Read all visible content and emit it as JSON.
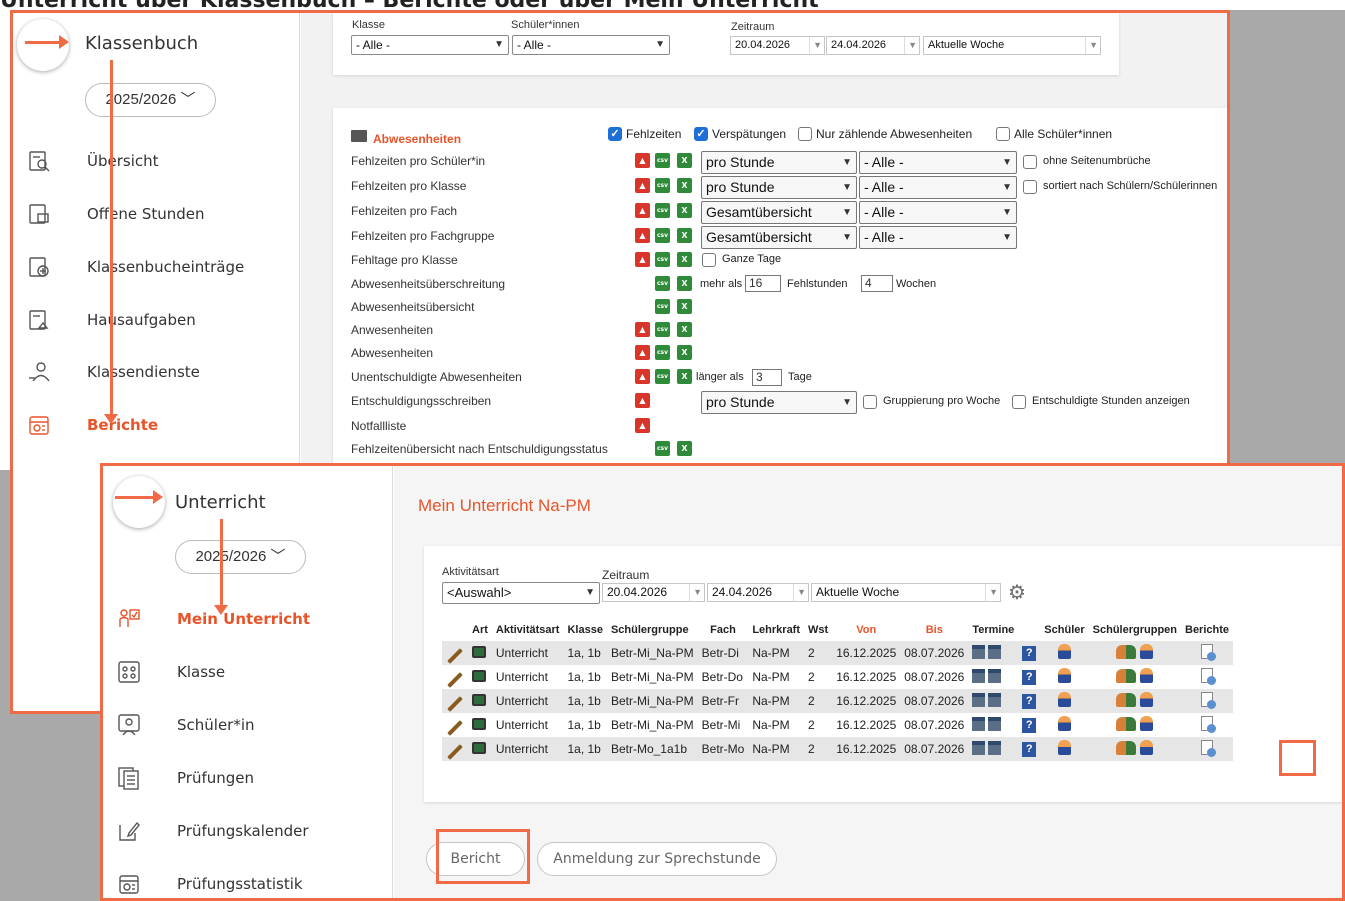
{
  "heading": "Unterricht über Klassenbuch – Berichte oder über Mein Unterricht",
  "colors": {
    "accent": "#e8542a",
    "highlight_border": "#ef6a45",
    "checkbox": "#1f6fd8",
    "pdf": "#d9352b",
    "excel": "#2f8a3a"
  },
  "klassenbuch": {
    "sidebar": {
      "title": "Klassenbuch",
      "school_year": "2025/2026",
      "items": [
        {
          "label": "Übersicht",
          "icon": "overview-icon"
        },
        {
          "label": "Offene Stunden",
          "icon": "open-lessons-icon"
        },
        {
          "label": "Klassenbucheinträge",
          "icon": "entry-icon"
        },
        {
          "label": "Hausaufgaben",
          "icon": "homework-icon"
        },
        {
          "label": "Klassendienste",
          "icon": "class-duties-icon"
        },
        {
          "label": "Berichte",
          "icon": "reports-icon",
          "active": true
        }
      ]
    },
    "filters": {
      "klasse_label": "Klasse",
      "klasse_value": "- Alle -",
      "schueler_label": "Schüler*innen",
      "schueler_value": "- Alle -",
      "zeitraum_label": "Zeitraum",
      "date_from": "20.04.2026",
      "date_to": "24.04.2026",
      "period": "Aktuelle Woche"
    },
    "absences": {
      "section_title": "Abwesenheiten",
      "options": {
        "fehlzeiten": "Fehlzeiten",
        "verspaetungen": "Verspätungen",
        "nur_zaehlende": "Nur zählende Abwesenheiten",
        "alle_schueler": "Alle Schüler*innen"
      },
      "rows": [
        {
          "label": "Fehlzeiten pro Schüler*in",
          "sel1": "pro Stunde",
          "sel2": "- Alle -",
          "extra": "ohne Seitenumbrüche"
        },
        {
          "label": "Fehlzeiten pro Klasse",
          "sel1": "pro Stunde",
          "sel2": "- Alle -",
          "extra": "sortiert nach Schülern/Schülerinnen"
        },
        {
          "label": "Fehlzeiten pro Fach",
          "sel1": "Gesamtübersicht",
          "sel2": "- Alle -"
        },
        {
          "label": "Fehlzeiten pro Fachgruppe",
          "sel1": "Gesamtübersicht",
          "sel2": "- Alle -"
        },
        {
          "label": "Fehltage pro Klasse",
          "extra": "Ganze Tage"
        },
        {
          "label": "Abwesenheitsüberschreitung",
          "pre": "mehr als",
          "num1": "16",
          "mid": "Fehlstunden",
          "num2": "4",
          "post": "Wochen"
        },
        {
          "label": "Abwesenheitsübersicht"
        },
        {
          "label": "Anwesenheiten"
        },
        {
          "label": "Abwesenheiten"
        },
        {
          "label": "Unentschuldigte Abwesenheiten",
          "pre": "länger als",
          "num1": "3",
          "post": "Tage"
        },
        {
          "label": "Entschuldigungsschreiben",
          "sel1": "pro Stunde",
          "extra": "Gruppierung pro Woche",
          "extra2": "Entschuldigte Stunden anzeigen"
        },
        {
          "label": "Notfallliste"
        },
        {
          "label": "Fehlzeitenübersicht nach Entschuldigungsstatus"
        }
      ],
      "csv_label": "csv",
      "xls_label": "X"
    }
  },
  "unterricht": {
    "sidebar": {
      "title": "Unterricht",
      "school_year": "2025/2026",
      "items": [
        {
          "label": "Mein Unterricht",
          "icon": "my-lessons-icon",
          "active": true
        },
        {
          "label": "Klasse",
          "icon": "class-icon"
        },
        {
          "label": "Schüler*in",
          "icon": "student-icon"
        },
        {
          "label": "Prüfungen",
          "icon": "exams-icon"
        },
        {
          "label": "Prüfungskalender",
          "icon": "exam-calendar-icon"
        },
        {
          "label": "Prüfungsstatistik",
          "icon": "exam-stats-icon"
        }
      ]
    },
    "page_title": "Mein Unterricht Na-PM",
    "filters": {
      "aktivitaetsart_label": "Aktivitätsart",
      "aktivitaetsart_value": "<Auswahl>",
      "zeitraum_label": "Zeitraum",
      "date_from": "20.04.2026",
      "date_to": "24.04.2026",
      "period": "Aktuelle Woche"
    },
    "table": {
      "headers": [
        "",
        "Art",
        "Aktivitätsart",
        "Klasse",
        "Schülergruppe",
        "Fach",
        "Lehrkraft",
        "Wst",
        "Von",
        "Bis",
        "Termine",
        "",
        "Schüler",
        "Schülergruppen",
        "Berichte"
      ],
      "rows": [
        {
          "aktivitaetsart": "Unterricht",
          "klasse": "1a, 1b",
          "gruppe": "Betr-Mi_Na-PM",
          "fach": "Betr-Di",
          "lehrkraft": "Na-PM",
          "wst": "2",
          "von": "16.12.2025",
          "bis": "08.07.2026"
        },
        {
          "aktivitaetsart": "Unterricht",
          "klasse": "1a, 1b",
          "gruppe": "Betr-Mi_Na-PM",
          "fach": "Betr-Do",
          "lehrkraft": "Na-PM",
          "wst": "2",
          "von": "16.12.2025",
          "bis": "08.07.2026"
        },
        {
          "aktivitaetsart": "Unterricht",
          "klasse": "1a, 1b",
          "gruppe": "Betr-Mi_Na-PM",
          "fach": "Betr-Fr",
          "lehrkraft": "Na-PM",
          "wst": "2",
          "von": "16.12.2025",
          "bis": "08.07.2026"
        },
        {
          "aktivitaetsart": "Unterricht",
          "klasse": "1a, 1b",
          "gruppe": "Betr-Mi_Na-PM",
          "fach": "Betr-Mi",
          "lehrkraft": "Na-PM",
          "wst": "2",
          "von": "16.12.2025",
          "bis": "08.07.2026"
        },
        {
          "aktivitaetsart": "Unterricht",
          "klasse": "1a, 1b",
          "gruppe": "Betr-Mo_1a1b",
          "fach": "Betr-Mo",
          "lehrkraft": "Na-PM",
          "wst": "2",
          "von": "16.12.2025",
          "bis": "08.07.2026"
        }
      ]
    },
    "buttons": {
      "bericht": "Bericht",
      "sprechstunde": "Anmeldung zur Sprechstunde"
    }
  }
}
